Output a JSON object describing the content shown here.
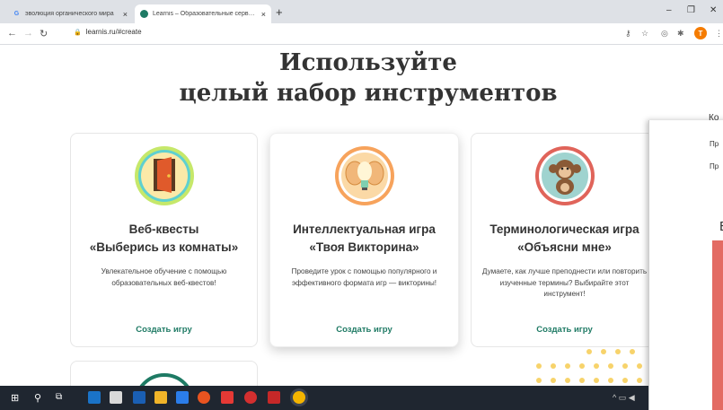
{
  "browser": {
    "tabs": [
      {
        "title": "эволюция органического мира",
        "favicon": "google-icon",
        "active": false
      },
      {
        "title": "Learnis – Образовательные сервисы",
        "favicon": "learnis-icon",
        "active": true
      }
    ],
    "new_tab": "+",
    "close_tab": "×",
    "url": "learnis.ru/#create",
    "avatar_letter": "T",
    "window_controls": {
      "minimize": "–",
      "maximize": "❐",
      "close": "✕"
    }
  },
  "page": {
    "headline_line1": "Используйте",
    "headline_line2": "целый набор инструментов",
    "cards": [
      {
        "title_line1": "Веб-квесты",
        "title_line2": "«Выберись из комнаты»",
        "description": "Увлекательное обучение с помощью образовательных веб-квестов!",
        "cta": "Создать игру",
        "icon": "door-icon"
      },
      {
        "title_line1": "Интеллектуальная игра",
        "title_line2": "«Твоя Викторина»",
        "description": "Проведите урок с помощью популярного и эффективного формата игр — викторины!",
        "cta": "Создать игру",
        "icon": "lightbulb-brain-icon"
      },
      {
        "title_line1": "Терминологическая игра",
        "title_line2": "«Объясни мне»",
        "description": "Думаете, как лучше преподнести или повторить изученные термины? Выбирайте этот инструмент!",
        "cta": "Создать игру",
        "icon": "monkey-icon"
      }
    ]
  },
  "overlay_window": {
    "title_fragment": "Ко",
    "line1": "Пр",
    "line2": "Пр",
    "big_letter": "Б"
  },
  "colors": {
    "accent": "#1e7a64",
    "card_border": "#e6e6e6",
    "taskbar": "#1f2630",
    "dot": "#f7d36b"
  }
}
